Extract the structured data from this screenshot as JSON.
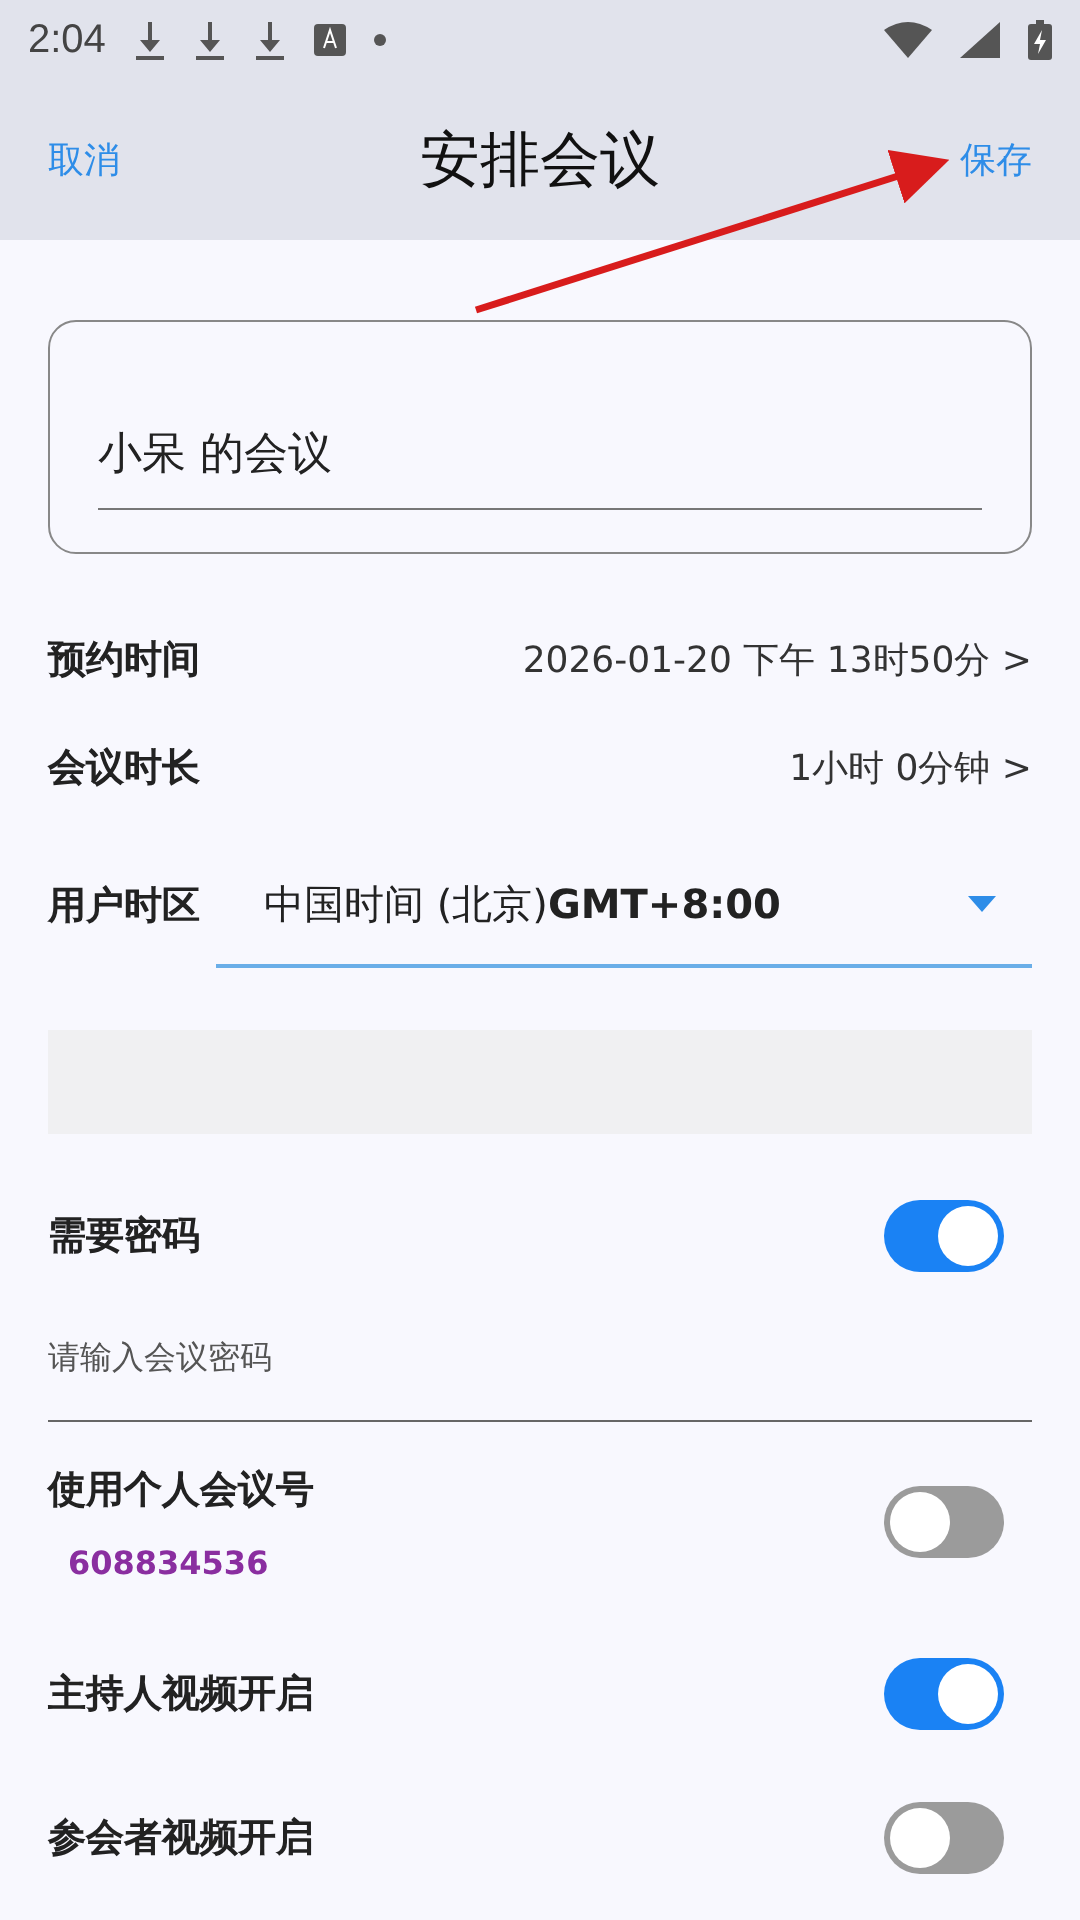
{
  "status_bar": {
    "time": "2:04"
  },
  "header": {
    "cancel": "取消",
    "title": "安排会议",
    "save": "保存"
  },
  "topic": {
    "value": "小呆 的会议"
  },
  "rows": [
    {
      "label": "预约时间",
      "value": "2026-01-20 下午 13时50分 >"
    },
    {
      "label": "会议时长",
      "value": "1小时 0分钟 >"
    }
  ],
  "timezone": {
    "label": "用户时区",
    "value": "中国时间 (北京)**GMT+8:00**"
  },
  "password": {
    "label": "需要密码",
    "on": true,
    "placeholder": "请输入会议密码"
  },
  "personal_id": {
    "label": "使用个人会议号",
    "on": false,
    "number": "608834536"
  },
  "switches": [
    {
      "label": "主持人视频开启",
      "on": true
    },
    {
      "label": "参会者视频开启",
      "on": false
    }
  ]
}
